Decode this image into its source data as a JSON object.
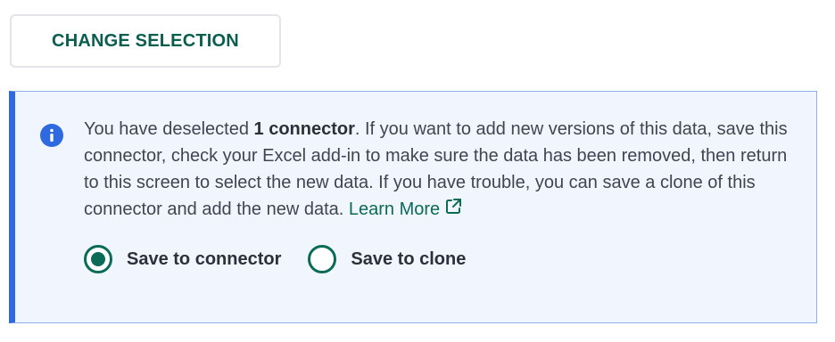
{
  "change_selection": {
    "label": "CHANGE SELECTION"
  },
  "banner": {
    "icon": "info-icon",
    "accent_color": "#2f69e0",
    "background_color": "#f1f5fd",
    "text_before": "You have deselected ",
    "count_text": "1 connector",
    "text_after": ". If you want to add new versions of this data, save this connector, check your Excel add-in to make sure the data has been removed, then return to this screen to select the new data. If you have trouble, you can save a clone of this connector and add the new data.",
    "learn_more_label": "Learn More",
    "learn_more_icon": "external-link-icon"
  },
  "options": [
    {
      "label": "Save to connector",
      "selected": true
    },
    {
      "label": "Save to clone",
      "selected": false
    }
  ],
  "colors": {
    "primary_green": "#0b6b57"
  }
}
